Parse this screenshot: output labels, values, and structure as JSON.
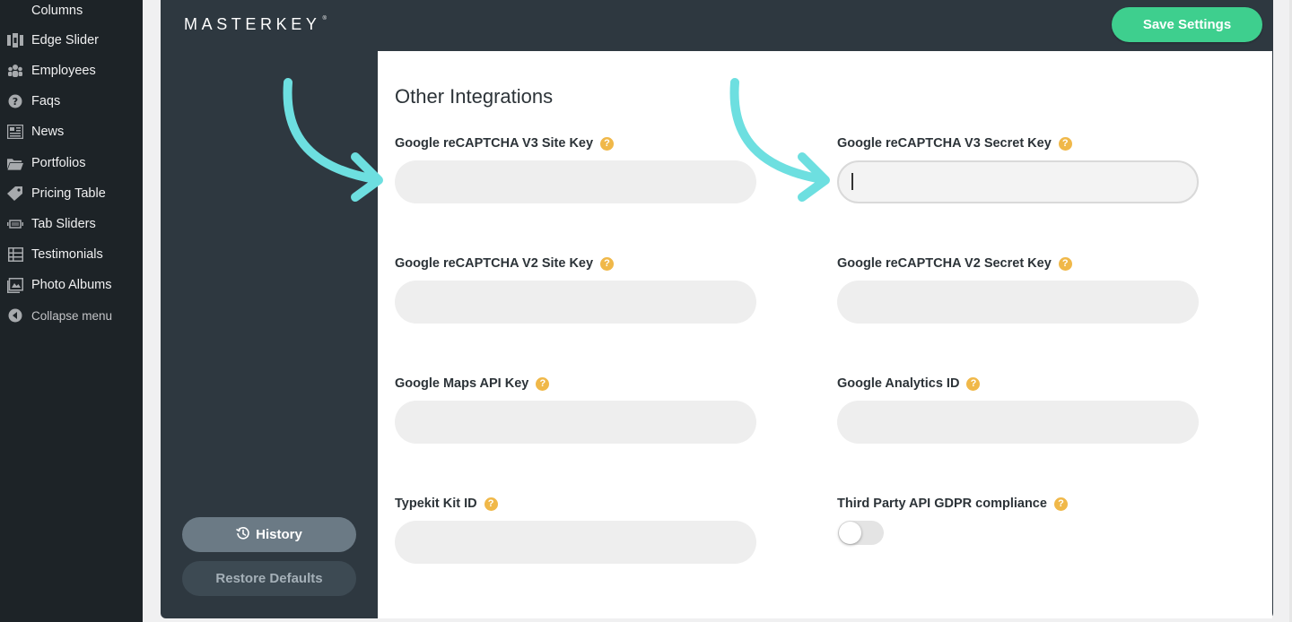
{
  "wp_menu": {
    "items": [
      {
        "label": "Columns",
        "icon": "columns-icon"
      },
      {
        "label": "Edge Slider",
        "icon": "slider-icon"
      },
      {
        "label": "Employees",
        "icon": "groups-icon"
      },
      {
        "label": "Faqs",
        "icon": "help-icon"
      },
      {
        "label": "News",
        "icon": "news-icon"
      },
      {
        "label": "Portfolios",
        "icon": "folder-icon"
      },
      {
        "label": "Pricing Table",
        "icon": "tag-icon"
      },
      {
        "label": "Tab Sliders",
        "icon": "tabs-icon"
      },
      {
        "label": "Testimonials",
        "icon": "layout-icon"
      },
      {
        "label": "Photo Albums",
        "icon": "gallery-icon"
      },
      {
        "label": "Collapse menu",
        "icon": "collapse-icon"
      }
    ]
  },
  "header": {
    "logo": "MASTERKEY",
    "logo_mark": "®",
    "save_label": "Save Settings"
  },
  "side": {
    "history_label": "History",
    "restore_label": "Restore Defaults"
  },
  "content": {
    "title": "Other Integrations",
    "help_glyph": "?",
    "fields": [
      {
        "label": "Google reCAPTCHA V3 Site Key",
        "value": ""
      },
      {
        "label": "Google reCAPTCHA V3 Secret Key",
        "value": "",
        "focused": true
      },
      {
        "label": "Google reCAPTCHA V2 Site Key",
        "value": ""
      },
      {
        "label": "Google reCAPTCHA V2 Secret Key",
        "value": ""
      },
      {
        "label": "Google Maps API Key",
        "value": ""
      },
      {
        "label": "Google Analytics ID",
        "value": ""
      },
      {
        "label": "Typekit Kit ID",
        "value": ""
      },
      {
        "label": "Third Party API GDPR compliance",
        "toggle": false
      }
    ]
  },
  "colors": {
    "accent_green": "#3ecf8e",
    "arrow_cyan": "#6ddfe0",
    "help_orange": "#f0b849",
    "panel_dark": "#2e3840",
    "wp_sidebar": "#1d2327"
  }
}
